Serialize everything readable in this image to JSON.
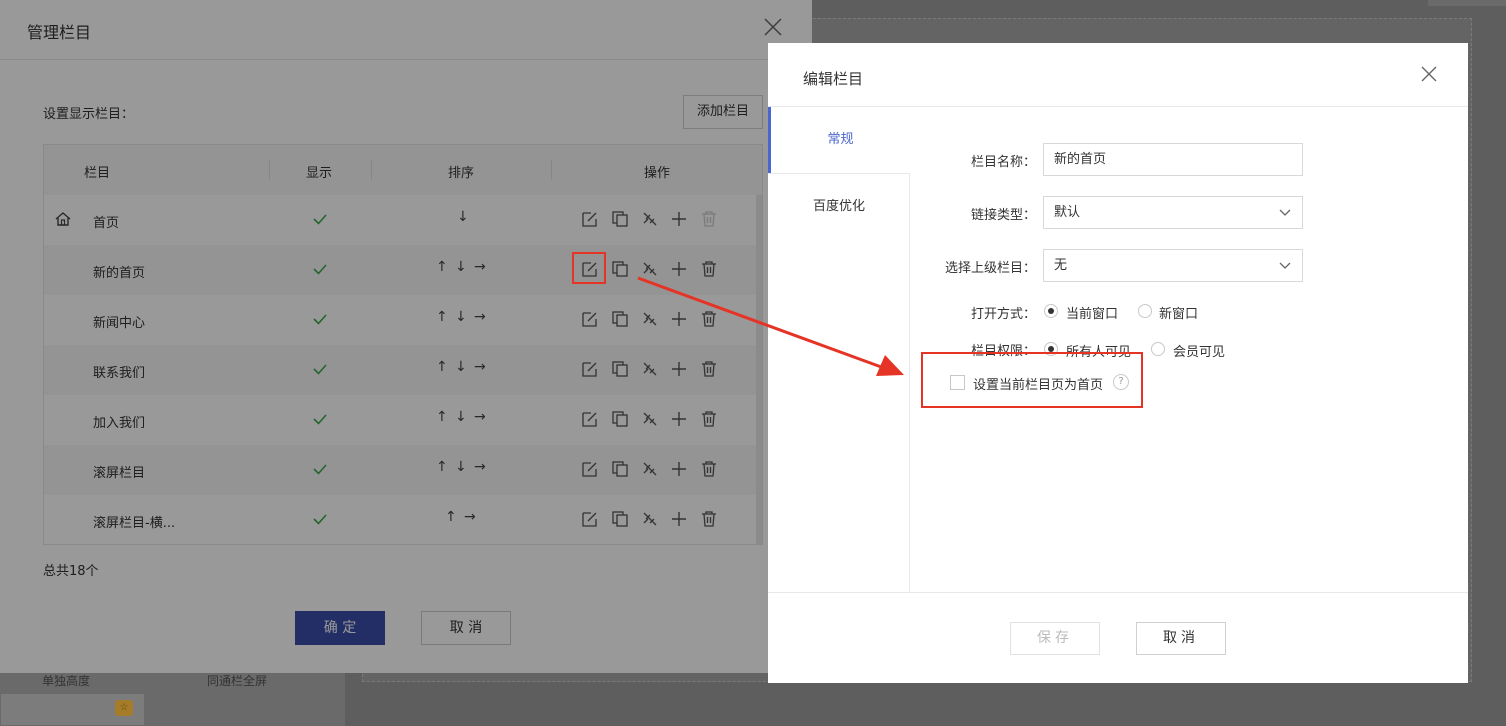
{
  "background": {
    "strip_labels": [
      "单独高度",
      "同通栏全屏"
    ],
    "badge": "☆"
  },
  "manage_dialog": {
    "title": "管理栏目",
    "label": "设置显示栏目：",
    "add_button": "添加栏目",
    "columns": [
      "栏目",
      "显示",
      "排序",
      "操作"
    ],
    "rows": [
      {
        "name": "首页",
        "home": true,
        "visible": true,
        "sort": [
          "↓"
        ],
        "delete_enabled": false
      },
      {
        "name": "新的首页",
        "home": false,
        "visible": true,
        "sort": [
          "↑",
          "↓",
          "→"
        ],
        "delete_enabled": true
      },
      {
        "name": "新闻中心",
        "home": false,
        "visible": true,
        "sort": [
          "↑",
          "↓",
          "→"
        ],
        "delete_enabled": true
      },
      {
        "name": "联系我们",
        "home": false,
        "visible": true,
        "sort": [
          "↑",
          "↓",
          "→"
        ],
        "delete_enabled": true
      },
      {
        "name": "加入我们",
        "home": false,
        "visible": true,
        "sort": [
          "↑",
          "↓",
          "→"
        ],
        "delete_enabled": true
      },
      {
        "name": "滚屏栏目",
        "home": false,
        "visible": true,
        "sort": [
          "↑",
          "↓",
          "→"
        ],
        "delete_enabled": true
      },
      {
        "name": "滚屏栏目-横...",
        "home": false,
        "visible": true,
        "sort": [
          "↑",
          "→"
        ],
        "delete_enabled": true
      }
    ],
    "total": "总共18个",
    "ok_button": "确 定",
    "cancel_button": "取 消"
  },
  "edit_dialog": {
    "title": "编辑栏目",
    "tabs": [
      "常规",
      "百度优化"
    ],
    "fields": {
      "name_label": "栏目名称：",
      "name_value": "新的首页",
      "link_label": "链接类型：",
      "link_value": "默认",
      "parent_label": "选择上级栏目：",
      "parent_value": "无",
      "open_label": "打开方式：",
      "open_options": [
        "当前窗口",
        "新窗口"
      ],
      "perm_label": "栏目权限：",
      "perm_options": [
        "所有人可见",
        "会员可见"
      ],
      "homepage_checkbox": "设置当前栏目页为首页",
      "help": "?"
    },
    "save_button": "保存",
    "cancel_button": "取消"
  },
  "colors": {
    "accent": "#4a66cf",
    "primary_button": "#3a4ea8",
    "annotation": "#e53326",
    "check": "#3da84a"
  }
}
